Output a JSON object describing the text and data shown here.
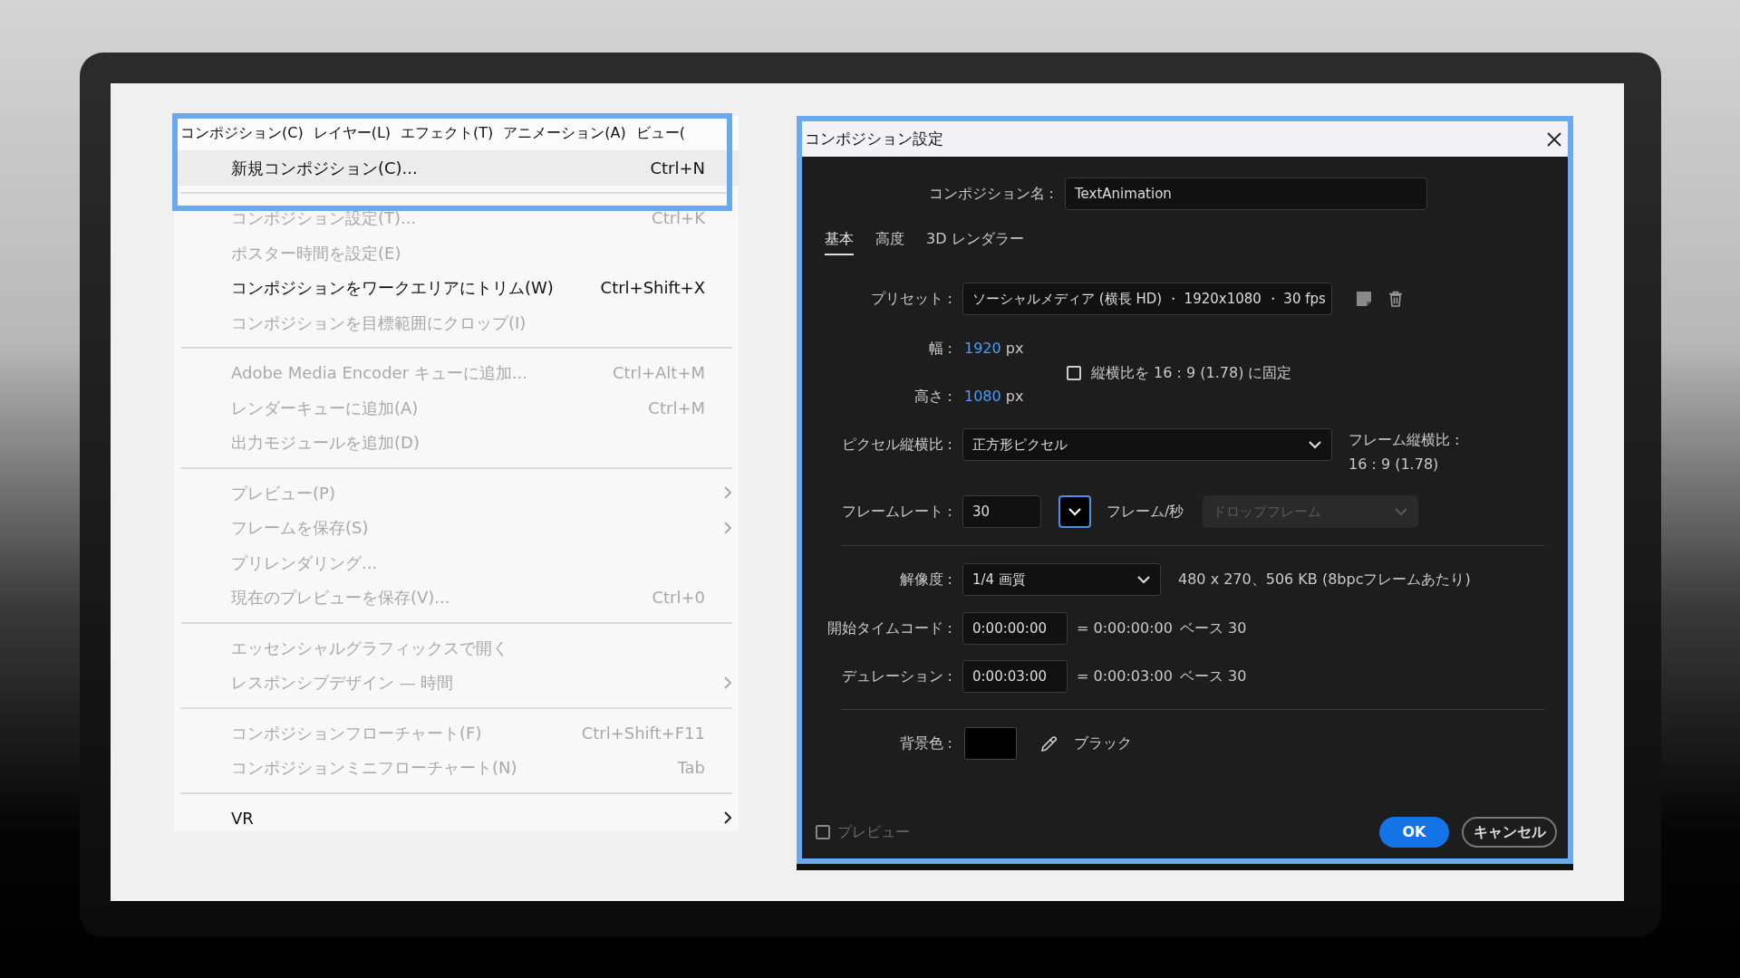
{
  "menu": {
    "menubar": [
      {
        "label": "コンポジション(C)"
      },
      {
        "label": "レイヤー(L)"
      },
      {
        "label": "エフェクト(T)"
      },
      {
        "label": "アニメーション(A)"
      },
      {
        "label": "ビュー("
      }
    ],
    "groups": [
      {
        "items": [
          {
            "label": "新規コンポジション(C)...",
            "shortcut": "Ctrl+N",
            "disabled": false,
            "highlighted": true,
            "submenu": false
          }
        ]
      },
      {
        "items": [
          {
            "label": "コンポジション設定(T)...",
            "shortcut": "Ctrl+K",
            "disabled": true,
            "highlighted": false,
            "submenu": false
          },
          {
            "label": "ポスター時間を設定(E)",
            "disabled": true,
            "highlighted": false,
            "submenu": false
          },
          {
            "label": "コンポジションをワークエリアにトリム(W)",
            "shortcut": "Ctrl+Shift+X",
            "disabled": false,
            "highlighted": false,
            "submenu": false
          },
          {
            "label": "コンポジションを目標範囲にクロップ(I)",
            "disabled": true,
            "highlighted": false,
            "submenu": false
          }
        ]
      },
      {
        "items": [
          {
            "label": "Adobe Media Encoder キューに追加...",
            "shortcut": "Ctrl+Alt+M",
            "disabled": true,
            "highlighted": false,
            "submenu": false
          },
          {
            "label": "レンダーキューに追加(A)",
            "shortcut": "Ctrl+M",
            "disabled": true,
            "highlighted": false,
            "submenu": false
          },
          {
            "label": "出力モジュールを追加(D)",
            "disabled": true,
            "highlighted": false,
            "submenu": false
          }
        ]
      },
      {
        "items": [
          {
            "label": "プレビュー(P)",
            "disabled": true,
            "highlighted": false,
            "submenu": true
          },
          {
            "label": "フレームを保存(S)",
            "disabled": true,
            "highlighted": false,
            "submenu": true
          },
          {
            "label": "プリレンダリング...",
            "disabled": true,
            "highlighted": false,
            "submenu": false
          },
          {
            "label": "現在のプレビューを保存(V)...",
            "shortcut": "Ctrl+0",
            "disabled": true,
            "highlighted": false,
            "submenu": false
          }
        ]
      },
      {
        "items": [
          {
            "label": "エッセンシャルグラフィックスで開く",
            "disabled": true,
            "highlighted": false,
            "submenu": false
          },
          {
            "label": "レスポンシブデザイン — 時間",
            "disabled": true,
            "highlighted": false,
            "submenu": true
          }
        ]
      },
      {
        "items": [
          {
            "label": "コンポジションフローチャート(F)",
            "shortcut": "Ctrl+Shift+F11",
            "disabled": true,
            "highlighted": false,
            "submenu": false
          },
          {
            "label": "コンポジションミニフローチャート(N)",
            "shortcut": "Tab",
            "disabled": true,
            "highlighted": false,
            "submenu": false
          }
        ]
      },
      {
        "items": [
          {
            "label": "VR",
            "disabled": false,
            "highlighted": false,
            "submenu": true
          }
        ]
      }
    ]
  },
  "dialog": {
    "title": "コンポジション設定",
    "name": {
      "label": "コンポジション名 :",
      "value": "TextAnimation"
    },
    "tabs": [
      {
        "label": "基本",
        "selected": true
      },
      {
        "label": "高度",
        "selected": false
      },
      {
        "label": "3D レンダラー",
        "selected": false
      }
    ],
    "preset": {
      "label": "プリセット :",
      "value": "ソーシャルメディア (横長 HD) ・ 1920x1080 ・ 30 fps"
    },
    "width": {
      "label": "幅 :",
      "value": "1920",
      "unit": "px"
    },
    "lock_aspect": {
      "label": "縦横比を 16 : 9 (1.78) に固定",
      "checked": false
    },
    "height": {
      "label": "高さ :",
      "value": "1080",
      "unit": "px"
    },
    "pixel_aspect": {
      "label": "ピクセル縦横比 :",
      "value": "正方形ピクセル"
    },
    "frame_aspect": {
      "label": "フレーム縦横比 :",
      "value": "16 : 9 (1.78)"
    },
    "frame_rate": {
      "label": "フレームレート :",
      "value": "30",
      "unit": "フレーム/秒",
      "drop_frame": {
        "value": "ドロップフレーム",
        "disabled": true
      }
    },
    "resolution": {
      "label": "解像度 :",
      "value": "1/4 画質",
      "info": "480 x 270、506 KB (8bpcフレームあたり)"
    },
    "timecodes": [
      {
        "label": "開始タイムコード :",
        "value": "0:00:00:00",
        "equals": "= 0:00:00:00",
        "base": "ベース 30"
      },
      {
        "label": "デュレーション :",
        "value": "0:00:03:00",
        "equals": "= 0:00:03:00",
        "base": "ベース 30"
      }
    ],
    "background": {
      "label": "背景色 :",
      "color": "#000000",
      "name": "ブラック"
    },
    "preview": {
      "label": "プレビュー",
      "checked": false,
      "disabled": true
    },
    "buttons": [
      {
        "label": "OK",
        "kind": "primary"
      },
      {
        "label": "キャンセル",
        "kind": "secondary"
      }
    ]
  }
}
